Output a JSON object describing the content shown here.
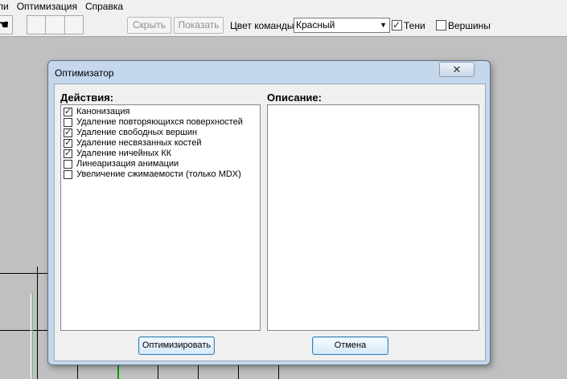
{
  "menu": {
    "items": [
      "ли",
      "Оптимизация",
      "Справка"
    ]
  },
  "toolbar": {
    "hand_icon": "hand-icon",
    "hide_label": "Скрыть",
    "show_label": "Показать",
    "team_color_label": "Цвет команды:",
    "team_color_value": "Красный",
    "shadows_label": "Тени",
    "shadows_checked": true,
    "vertices_label": "Вершины",
    "vertices_checked": false
  },
  "dialog": {
    "title": "Оптимизатор",
    "close_symbol": "✕",
    "actions_label": "Действия:",
    "description_label": "Описание:",
    "actions": [
      {
        "label": "Канонизация",
        "checked": true
      },
      {
        "label": "Удаление повторяющихся поверхностей",
        "checked": false
      },
      {
        "label": "Удаление свободных вершин",
        "checked": true
      },
      {
        "label": "Удаление несвязанных костей",
        "checked": true
      },
      {
        "label": "Удаление ничейных КК",
        "checked": true
      },
      {
        "label": "Линеаризация анимации",
        "checked": false
      },
      {
        "label": "Увеличение сжимаемости (только MDX)",
        "checked": false
      }
    ],
    "description_text": "",
    "optimize_label": "Оптимизировать",
    "cancel_label": "Отмена"
  },
  "colors": {
    "viewport_bg": "#c0c0c0",
    "dialog_frame": "#c4d7ec",
    "accent_green": "#00a000"
  }
}
